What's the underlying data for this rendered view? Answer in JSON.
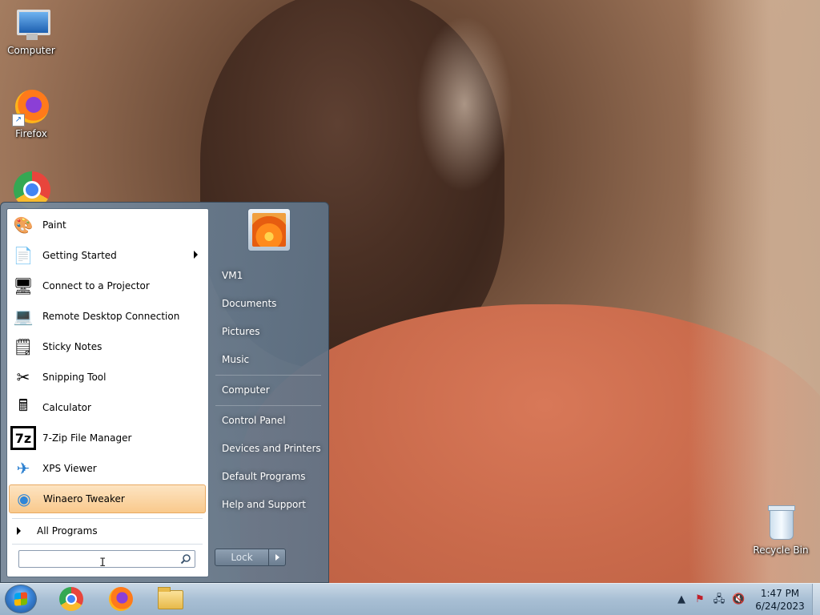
{
  "desktop": {
    "icons": [
      {
        "label": "Computer",
        "icon": "computer-icon"
      },
      {
        "label": "Firefox",
        "icon": "firefox-icon"
      },
      {
        "label": "",
        "icon": "chrome-icon"
      },
      {
        "label": "Recycle Bin",
        "icon": "recycle-bin-icon"
      }
    ]
  },
  "start_menu": {
    "programs": [
      {
        "label": "Paint",
        "icon": "paint-icon",
        "submenu": false
      },
      {
        "label": "Getting Started",
        "icon": "getting-started-icon",
        "submenu": true
      },
      {
        "label": "Connect to a Projector",
        "icon": "projector-icon",
        "submenu": false
      },
      {
        "label": "Remote Desktop Connection",
        "icon": "remote-desktop-icon",
        "submenu": false
      },
      {
        "label": "Sticky Notes",
        "icon": "sticky-notes-icon",
        "submenu": false
      },
      {
        "label": "Snipping Tool",
        "icon": "snipping-tool-icon",
        "submenu": false
      },
      {
        "label": "Calculator",
        "icon": "calculator-icon",
        "submenu": false
      },
      {
        "label": "7-Zip File Manager",
        "icon": "7zip-icon",
        "submenu": false
      },
      {
        "label": "XPS Viewer",
        "icon": "xps-viewer-icon",
        "submenu": false
      },
      {
        "label": "Winaero Tweaker",
        "icon": "winaero-tweaker-icon",
        "submenu": false,
        "selected": true
      }
    ],
    "all_programs_label": "All Programs",
    "search": {
      "value": "",
      "placeholder": ""
    },
    "seven_zip_glyph": "7z",
    "right_links": [
      {
        "label": "VM1"
      },
      {
        "label": "Documents"
      },
      {
        "label": "Pictures"
      },
      {
        "label": "Music"
      },
      {
        "label": "Computer"
      },
      {
        "label": "Control Panel"
      },
      {
        "label": "Devices and Printers"
      },
      {
        "label": "Default Programs"
      },
      {
        "label": "Help and Support"
      }
    ],
    "lock_label": "Lock"
  },
  "taskbar": {
    "pinned": [
      "chrome-icon",
      "firefox-icon",
      "file-explorer-icon"
    ],
    "tray_icons": [
      "show-hidden-icons-arrow",
      "action-center-flag-icon",
      "network-icon",
      "volume-muted-icon"
    ],
    "clock": {
      "time": "1:47 PM",
      "date": "6/24/2023"
    }
  },
  "colors": {
    "selection_highlight": "#f9c98c",
    "taskbar": "#a8bfd4",
    "menu_right_pane": "#6f8398"
  }
}
